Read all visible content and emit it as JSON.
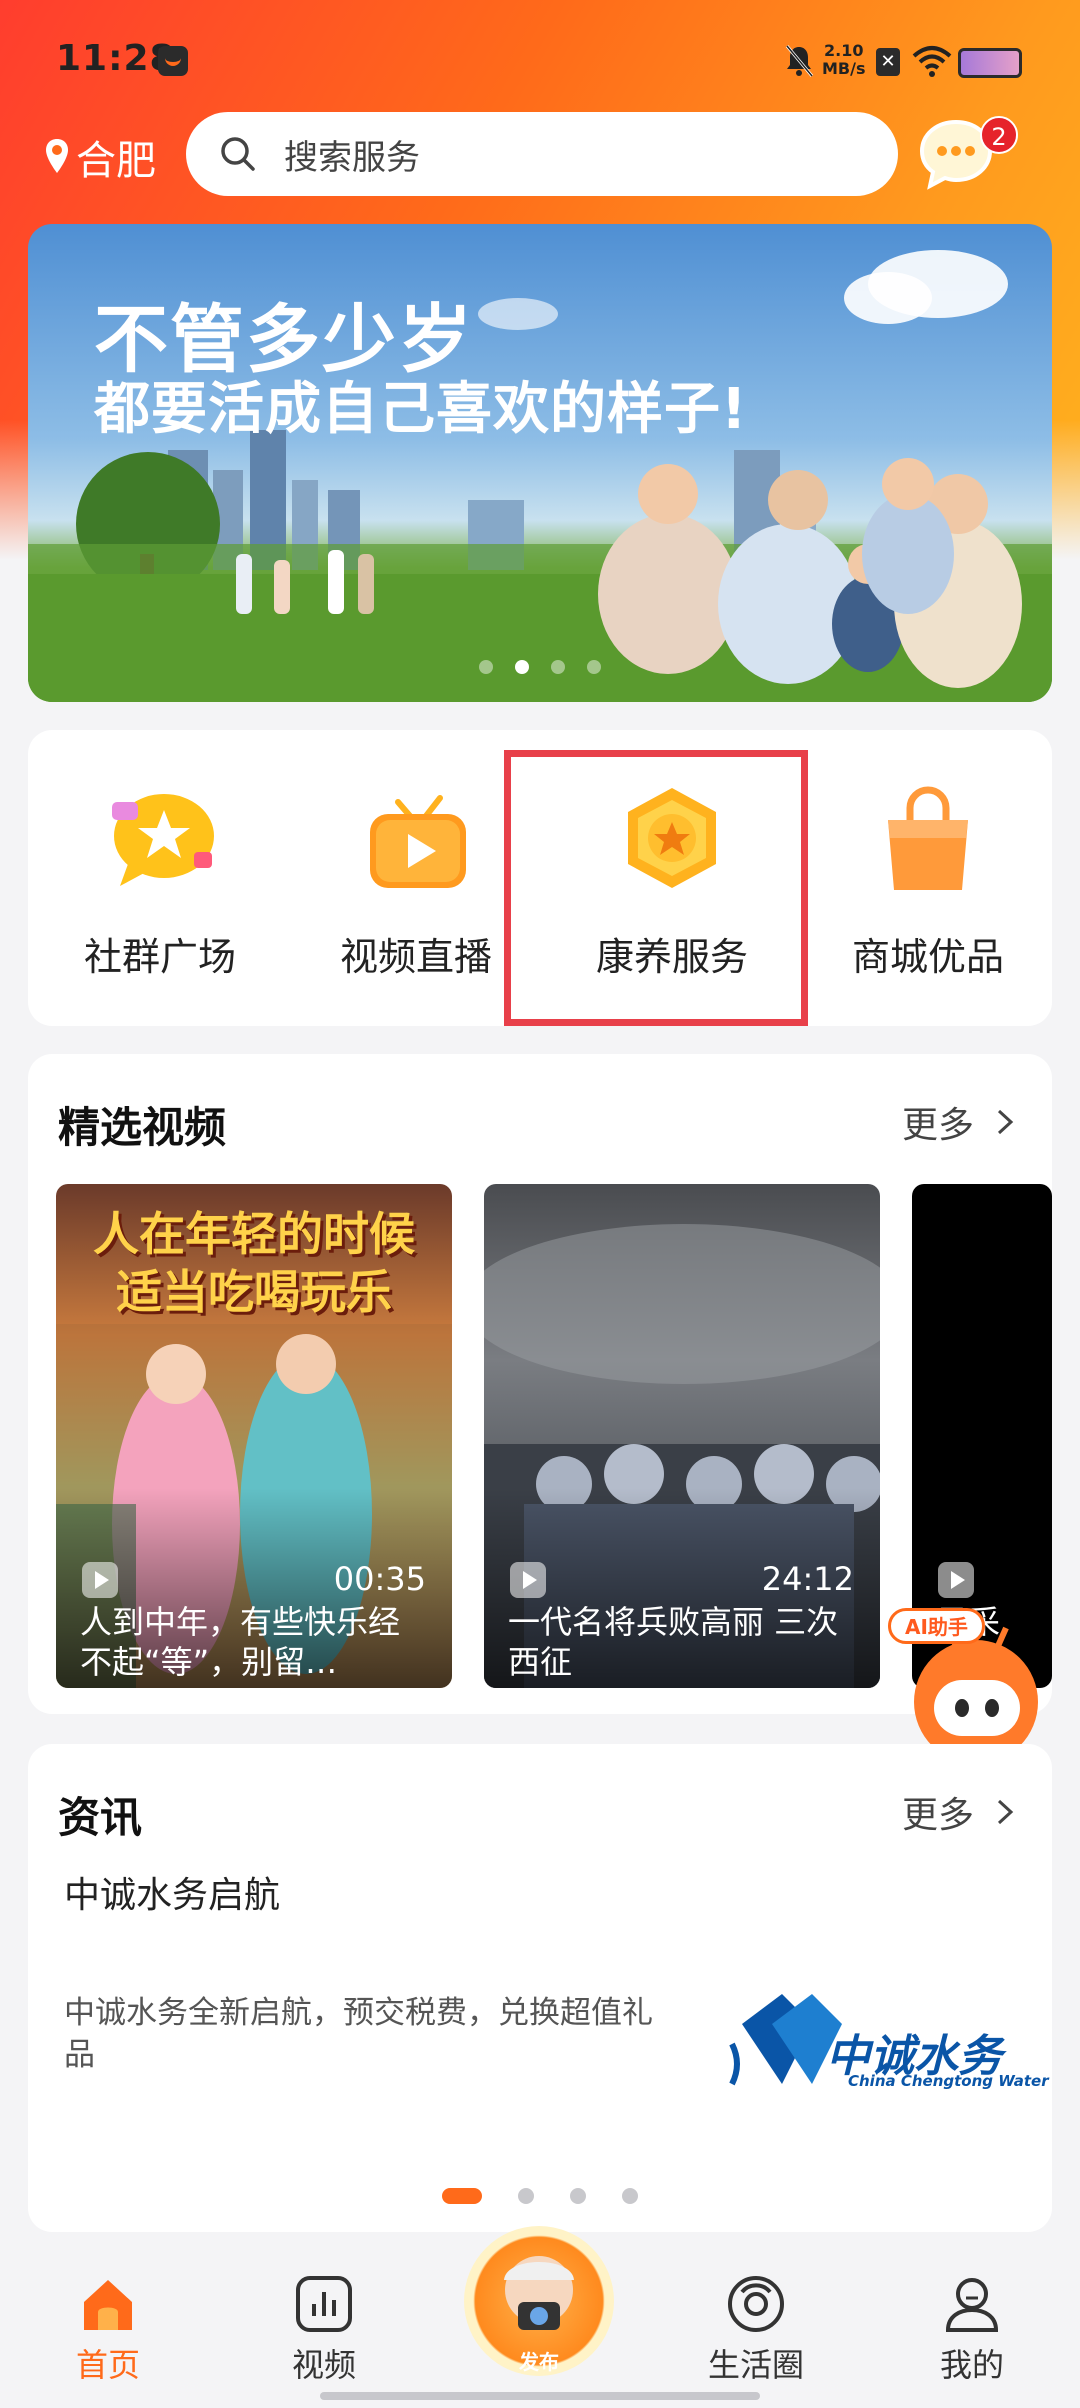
{
  "status_bar": {
    "time": "11:28",
    "net_speed_value": "2.10",
    "net_speed_unit": "MB/s"
  },
  "header": {
    "location": "合肥",
    "search_placeholder": "搜索服务",
    "chat_badge_count": "2"
  },
  "banner": {
    "title_line1": "不管多少岁",
    "title_line2": "都要活成自己喜欢的样子!",
    "page_index": 2,
    "page_count": 4
  },
  "quick_menu": [
    {
      "label": "社群广场",
      "icon": "community-plaza-icon"
    },
    {
      "label": "视频直播",
      "icon": "video-live-icon"
    },
    {
      "label": "康养服务",
      "icon": "wellness-service-icon"
    },
    {
      "label": "商城优品",
      "icon": "shopping-bag-icon"
    }
  ],
  "videos": {
    "section_title": "精选视频",
    "more_label": "更多",
    "items": [
      {
        "caption_line1": "人在年轻的时候",
        "caption_line2": "适当吃喝玩乐",
        "duration": "00:35",
        "title": "人到中年，有些快乐经不起“等”，别留…"
      },
      {
        "duration": "24:12",
        "title": "一代名将兵败高丽 三次西征"
      },
      {
        "title": "风采"
      }
    ]
  },
  "ai_helper": {
    "tag": "AI助手"
  },
  "news": {
    "section_title": "资讯",
    "more_label": "更多",
    "headline": "中诚水务启航",
    "description": "中诚水务全新启航，预交税费，兑换超值礼品",
    "logo_cn": "中诚水务",
    "logo_en": "China Chengtong Water",
    "page_index": 1,
    "page_count": 4
  },
  "tabbar": {
    "items": [
      {
        "label": "首页",
        "icon": "home-icon",
        "active": true
      },
      {
        "label": "视频",
        "icon": "video-chart-icon",
        "active": false
      },
      {
        "label": "发布",
        "icon": "publish-camera-icon",
        "active": false
      },
      {
        "label": "生活圈",
        "icon": "life-circle-icon",
        "active": false
      },
      {
        "label": "我的",
        "icon": "profile-icon",
        "active": false
      }
    ]
  },
  "colors": {
    "accent": "#ff6a1a",
    "highlight_box": "#e8404a",
    "badge": "#e6232b",
    "brand_blue": "#0a55a7"
  }
}
